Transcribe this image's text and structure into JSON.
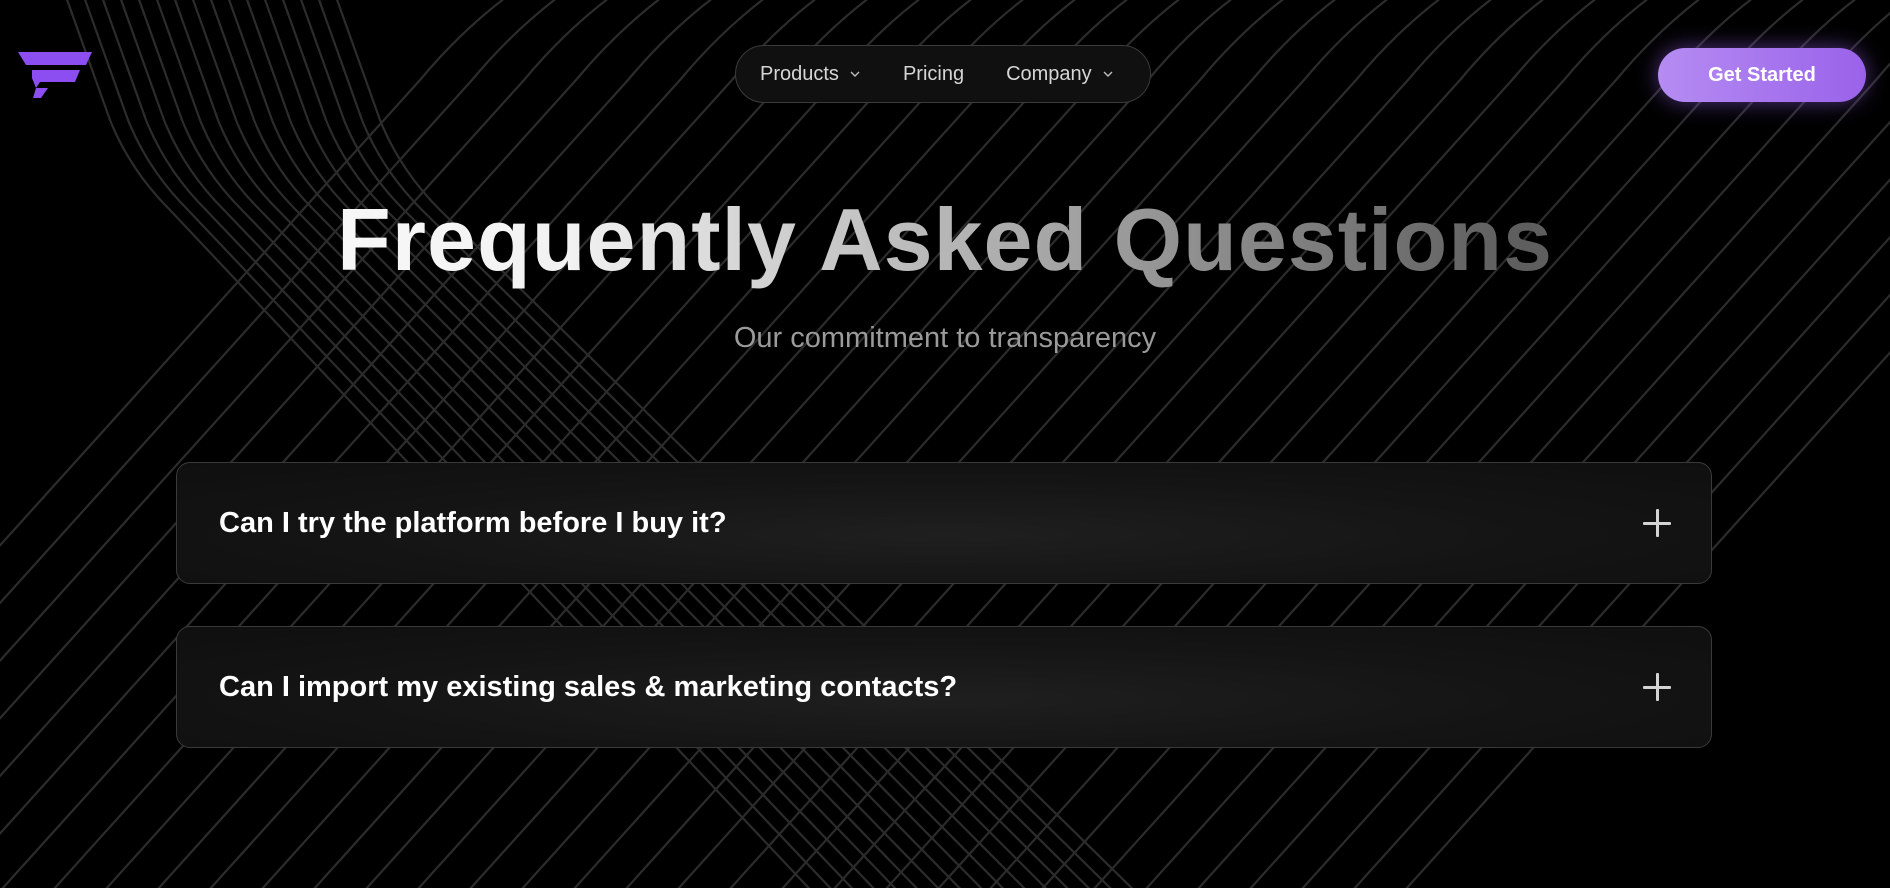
{
  "brand": {
    "logo_icon": "brand-logo-icon",
    "accent_color": "#9a62ea"
  },
  "nav": {
    "items": [
      {
        "label": "Products",
        "has_dropdown": true,
        "icon": "chevron-down-icon"
      },
      {
        "label": "Pricing",
        "has_dropdown": false
      },
      {
        "label": "Company",
        "has_dropdown": true,
        "icon": "chevron-down-icon"
      }
    ]
  },
  "cta": {
    "label": "Get Started"
  },
  "hero": {
    "title": "Frequently Asked Questions",
    "subtitle": "Our commitment to transparency"
  },
  "faq": {
    "items": [
      {
        "question": "Can I try the platform before I buy it?",
        "icon": "plus-icon",
        "expanded": false
      },
      {
        "question": "Can I import my existing sales & marketing contacts?",
        "icon": "plus-icon",
        "expanded": false
      }
    ]
  }
}
